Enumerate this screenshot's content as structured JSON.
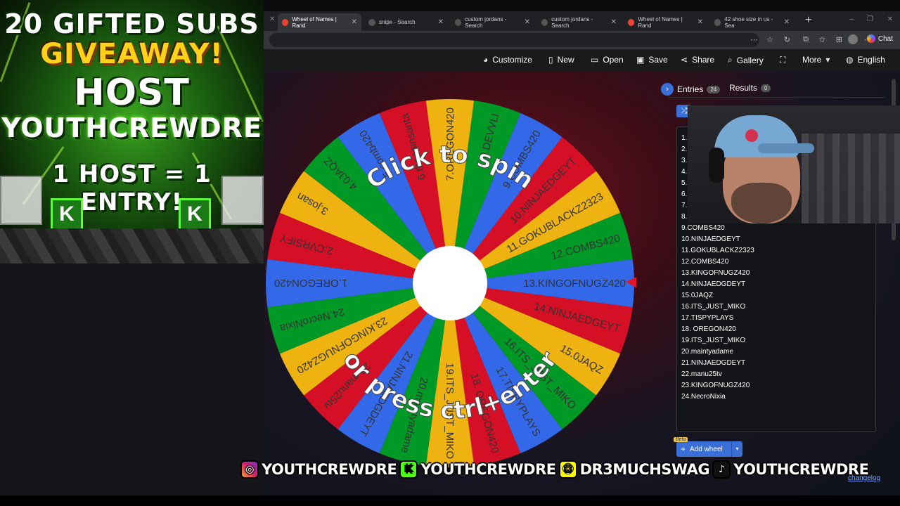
{
  "promo": {
    "line1": "20 GIFTED SUBS",
    "line2": "GIVEAWAY!",
    "line3": "HOST",
    "line4": "YOUTHCREWDRE",
    "line5": "1 HOST = 1 ENTRY!",
    "badge": "K"
  },
  "tabs": [
    {
      "title": "Wheel of Names | Rand",
      "fav": "#ea4335",
      "active": true
    },
    {
      "title": "snipe - Search",
      "fav": "#555"
    },
    {
      "title": "custom jordans - Search",
      "fav": "#555"
    },
    {
      "title": "custom jordans - Search",
      "fav": "#555"
    },
    {
      "title": "Wheel of Names | Rand",
      "fav": "#ea4335"
    },
    {
      "title": "42 shoe size in us - Sea",
      "fav": "#555"
    }
  ],
  "address": {
    "chat_label": "Chat"
  },
  "toolbar": {
    "customize": "Customize",
    "new": "New",
    "open": "Open",
    "save": "Save",
    "share": "Share",
    "gallery": "Gallery",
    "more": "More",
    "language": "English"
  },
  "wheel": {
    "spin_top": "Click to spin",
    "spin_bottom": "or press ctrl+enter",
    "slice_colors": [
      "#3369e8",
      "#d50f25",
      "#eeb211",
      "#009925"
    ],
    "slices": [
      "1.OREGON420",
      "2.CVRSIFY",
      "3.josan",
      "4.0JAQZ",
      "5.comb420",
      "6.thesainsanta",
      "7.OREGON420",
      "8.DEVVLI",
      "9.COMBS420",
      "10.NINJAEDGEYT",
      "11.GOKUBLACKZ2323",
      "12.COMBS420",
      "13.KINGOFNUGZ420",
      "14.NINJAEDGEYT",
      "15.0JAQZ",
      "16.ITS_JUST_MIKO",
      "17.TISPYPLAYS",
      "18. OREGON420",
      "19.ITS_JUST_MIKO",
      "20.maintyadame",
      "21.NINJAEDGDEYT",
      "22.manu25tv",
      "23.KINGOFNUGZ420",
      "24.NecroNixia"
    ]
  },
  "panel": {
    "entries_label": "Entries",
    "entries_count": "24",
    "results_label": "Results",
    "results_count": "0",
    "entries": [
      "1.",
      "2.",
      "3.",
      "4.",
      "5.",
      "6.",
      "7.",
      "8.",
      "9.COMBS420",
      "10.NINJAEDGEYT",
      "11.GOKUBLACKZ2323",
      "12.COMBS420",
      "13.KINGOFNUGZ420",
      "14.NINJAEDGDEYT",
      "15.0JAQZ",
      "16.ITS_JUST_MIKO",
      "17.TISPYPLAYS",
      "18. OREGON420",
      "19.ITS_JUST_MIKO",
      "20.maintyadame",
      "21.NINJAEDGDEYT",
      "22.manu25tv",
      "23.KINGOFNUGZ420",
      "24.NecroNixia"
    ],
    "beta": "Beta",
    "add_wheel": "Add wheel",
    "changelog": "changelog"
  },
  "socials": [
    {
      "icon": "instagram-icon",
      "glyph": "◎",
      "handle": "YOUTHCREWDRE"
    },
    {
      "icon": "kick-icon",
      "glyph": "K",
      "handle": "YOUTHCREWDRE"
    },
    {
      "icon": "snapchat-icon",
      "glyph": "☺",
      "handle": "DR3MUCHSWAG"
    },
    {
      "icon": "tiktok-icon",
      "glyph": "♪",
      "handle": "YOUTHCREWDRE"
    }
  ]
}
